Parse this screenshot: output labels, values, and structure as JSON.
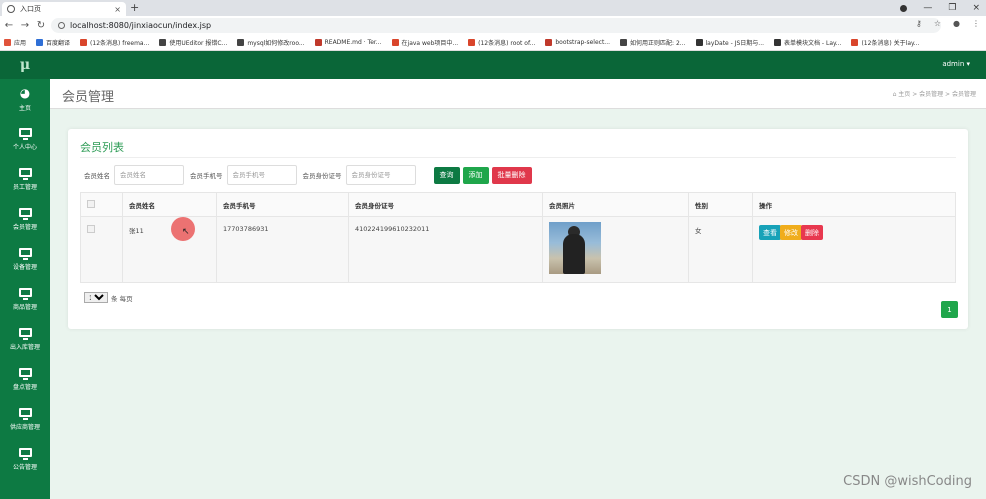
{
  "browser": {
    "tab_title": "入口页",
    "tab_close": "×",
    "new_tab": "+",
    "url": "localhost:8080/jinxiaocun/index.jsp",
    "window_controls": [
      "—",
      "❐",
      "×"
    ],
    "bookmarks": [
      {
        "label": "应用",
        "color": "#e0533b"
      },
      {
        "label": "百度翻译",
        "color": "#2f6fd6"
      },
      {
        "label": "(12条消息) freema...",
        "color": "#d9452b"
      },
      {
        "label": "使用UEditor 报错C...",
        "color": "#444444"
      },
      {
        "label": "mysql如何修改roo...",
        "color": "#444444"
      },
      {
        "label": "README.md · Ter...",
        "color": "#c0392b"
      },
      {
        "label": "在java web项目中...",
        "color": "#d9452b"
      },
      {
        "label": "(12条消息) root of...",
        "color": "#d9452b"
      },
      {
        "label": "bootstrap-select...",
        "color": "#c0392b"
      },
      {
        "label": "如何用正则匹配: 2...",
        "color": "#444444"
      },
      {
        "label": "layDate - JS日期与...",
        "color": "#333333"
      },
      {
        "label": "表单模块文档 - Lay...",
        "color": "#333333"
      },
      {
        "label": "(12条消息) 关于lay...",
        "color": "#d9452b"
      }
    ]
  },
  "app": {
    "logo": "μ",
    "admin": "admin ▾",
    "colors": {
      "sidebar": "#0d7a43",
      "topbar": "#0a6638",
      "accent": "#2e9c56",
      "content_bg": "#eaf4ee"
    },
    "sidebar": [
      {
        "label": "主页",
        "icon": "dashboard-icon"
      },
      {
        "label": "个人中心",
        "icon": "monitor-icon"
      },
      {
        "label": "员工管理",
        "icon": "monitor-icon"
      },
      {
        "label": "会员管理",
        "icon": "monitor-icon"
      },
      {
        "label": "设备管理",
        "icon": "monitor-icon"
      },
      {
        "label": "商品管理",
        "icon": "monitor-icon"
      },
      {
        "label": "出入库管理",
        "icon": "monitor-icon"
      },
      {
        "label": "盘点管理",
        "icon": "monitor-icon"
      },
      {
        "label": "供应商管理",
        "icon": "monitor-icon"
      },
      {
        "label": "公告管理",
        "icon": "monitor-icon"
      }
    ],
    "page_title": "会员管理",
    "breadcrumb": "⌂ 主页  >  会员管理  >  会员管理",
    "card_title": "会员列表",
    "search": {
      "name_label": "会员姓名",
      "name_placeholder": "会员姓名",
      "phone_label": "会员手机号",
      "phone_placeholder": "会员手机号",
      "id_label": "会员身份证号",
      "id_placeholder": "会员身份证号",
      "search_btn": "查询",
      "add_btn": "添加",
      "batch_delete_btn": "批量删除"
    },
    "table": {
      "headers": [
        "会员姓名",
        "会员手机号",
        "会员身份证号",
        "会员照片",
        "性别",
        "操作"
      ],
      "rows": [
        {
          "name": "张11",
          "phone": "17703786931",
          "id_no": "410224199610232011",
          "gender": "女"
        }
      ],
      "actions": {
        "view": "查看",
        "edit": "修改",
        "delete": "删除"
      }
    },
    "page_size": "10",
    "page_size_suffix": "条 每页",
    "current_page": "1"
  },
  "watermark": "CSDN @wishCoding"
}
